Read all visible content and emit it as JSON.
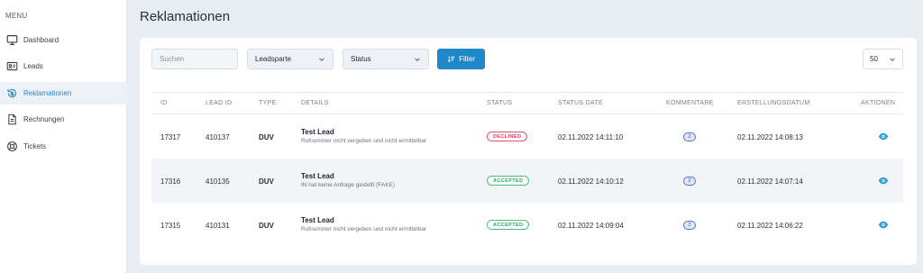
{
  "sidebar": {
    "menu_label": "MENU",
    "items": [
      {
        "label": "Dashboard",
        "icon": "monitor-icon"
      },
      {
        "label": "Leads",
        "icon": "id-card-icon"
      },
      {
        "label": "Reklamationen",
        "icon": "refund-icon",
        "active": true
      },
      {
        "label": "Rechnungen",
        "icon": "invoice-icon"
      },
      {
        "label": "Tickets",
        "icon": "lifebuoy-icon"
      }
    ]
  },
  "page": {
    "title": "Reklamationen"
  },
  "toolbar": {
    "search_placeholder": "Suchen",
    "leadsparte_label": "Leadsparte",
    "status_label": "Status",
    "filter_label": "Filter",
    "page_size": "50"
  },
  "table": {
    "headers": {
      "id": "ID",
      "lead_id": "LEAD ID",
      "type": "TYPE",
      "details": "DETAILS",
      "status": "STATUS",
      "status_date": "STATUS DATE",
      "kommentare": "KOMMENTARE",
      "erstellungsdatum": "ERSTELLUNGSDATUM",
      "aktionen": "AKTIONEN"
    },
    "rows": [
      {
        "id": "17317",
        "lead_id": "410137",
        "type": "DUV",
        "details_title": "Test Lead",
        "details_sub": "Rufnummer nicht vergeben und nicht ermittelbar",
        "status": "DECLINED",
        "status_date": "02.11.2022 14:11:10",
        "kommentare": "2",
        "erstellungsdatum": "02.11.2022 14:08:13"
      },
      {
        "id": "17316",
        "lead_id": "410135",
        "type": "DUV",
        "details_title": "Test Lead",
        "details_sub": "IN hat keine Anfrage gestellt (FAKE)",
        "status": "ACCEPTED",
        "status_date": "02.11.2022 14:10:12",
        "kommentare": "2",
        "erstellungsdatum": "02.11.2022 14:07:14"
      },
      {
        "id": "17315",
        "lead_id": "410131",
        "type": "DUV",
        "details_title": "Test Lead",
        "details_sub": "Rufnummer nicht vergeben und nicht ermittelbar",
        "status": "ACCEPTED",
        "status_date": "02.11.2022 14:09:04",
        "kommentare": "2",
        "erstellungsdatum": "02.11.2022 14:06:22"
      }
    ]
  },
  "colors": {
    "accent": "#1e88c9",
    "declined": "#d23b55",
    "accepted": "#2f9e5e",
    "background": "#e8edf3"
  }
}
